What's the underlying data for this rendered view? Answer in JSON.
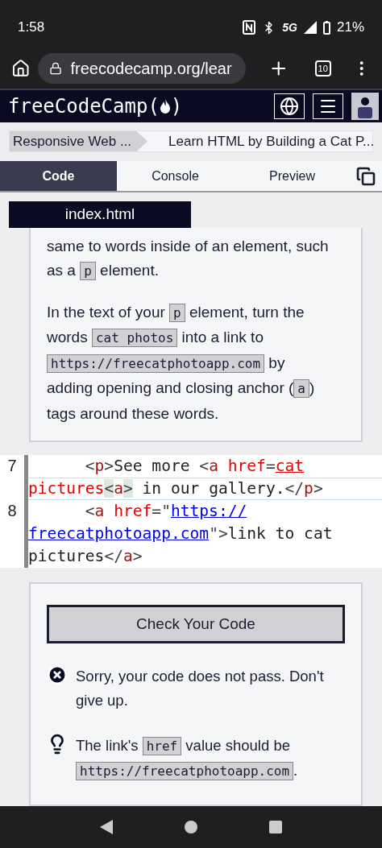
{
  "status_bar": {
    "time": "1:58",
    "network": "5G",
    "battery": "21%"
  },
  "browser": {
    "url": "freecodecamp.org/lear",
    "tab_count": "10"
  },
  "nav": {
    "logo_text": "freeCodeCamp",
    "logo_open": "(",
    "logo_close": ")"
  },
  "breadcrumb": [
    {
      "label": "Responsive Web ..."
    },
    {
      "label": "Learn HTML by Building a Cat P..."
    }
  ],
  "tabs": [
    {
      "label": "Code",
      "selected": true
    },
    {
      "label": "Console",
      "selected": false
    },
    {
      "label": "Preview",
      "selected": false
    }
  ],
  "file_tabs": [
    {
      "label": "index.html",
      "selected": true
    }
  ],
  "instructions": [
    [
      {
        "kind": "text",
        "text": "same to words inside of an element, such as a "
      },
      {
        "kind": "code",
        "text": "p"
      },
      {
        "kind": "text",
        "text": " element."
      }
    ],
    [
      {
        "kind": "text",
        "text": "In the text of your "
      },
      {
        "kind": "code",
        "text": "p"
      },
      {
        "kind": "text",
        "text": " element, turn the words "
      },
      {
        "kind": "code",
        "text": "cat photos"
      },
      {
        "kind": "text",
        "text": " into a link to "
      },
      {
        "kind": "code",
        "text": "https://freecatphotoapp.com"
      },
      {
        "kind": "text",
        "text": " by adding opening and closing anchor ("
      },
      {
        "kind": "code",
        "text": "a"
      },
      {
        "kind": "text",
        "text": ") tags around these words."
      }
    ]
  ],
  "editor": [
    {
      "number": "7",
      "rows": [
        {
          "tokens": [
            {
              "kind": "punct",
              "text": "<"
            },
            {
              "kind": "tag",
              "text": "p"
            },
            {
              "kind": "punct",
              "text": ">"
            },
            {
              "kind": "text",
              "text": "See more "
            },
            {
              "kind": "punct",
              "text": "<"
            },
            {
              "kind": "tag",
              "text": "a"
            },
            {
              "kind": "attr",
              "text": " href"
            },
            {
              "kind": "punct",
              "text": "="
            },
            {
              "kind": "error",
              "text": "cat"
            }
          ]
        },
        {
          "tokens": [
            {
              "kind": "attr",
              "text": "pictures"
            },
            {
              "kind": "match",
              "text": "<"
            },
            {
              "kind": "tag",
              "text": "a"
            },
            {
              "kind": "match",
              "text": ">"
            },
            {
              "kind": "text",
              "text": " in our gallery."
            },
            {
              "kind": "punct",
              "text": "</"
            },
            {
              "kind": "tag",
              "text": "p"
            },
            {
              "kind": "punct",
              "text": ">"
            }
          ]
        }
      ]
    },
    {
      "number": "8",
      "rows": [
        {
          "tokens": [
            {
              "kind": "punct",
              "text": "<"
            },
            {
              "kind": "tag",
              "text": "a"
            },
            {
              "kind": "attr",
              "text": " href"
            },
            {
              "kind": "punct",
              "text": "=\""
            },
            {
              "kind": "url",
              "text": "https://"
            }
          ]
        },
        {
          "tokens": [
            {
              "kind": "url",
              "text": "freecatphotoapp.com"
            },
            {
              "kind": "punct",
              "text": "\">"
            },
            {
              "kind": "text",
              "text": "link to cat"
            }
          ]
        },
        {
          "tokens": [
            {
              "kind": "text",
              "text": "pictures"
            },
            {
              "kind": "punct",
              "text": "</"
            },
            {
              "kind": "tag",
              "text": "a"
            },
            {
              "kind": "punct",
              "text": ">"
            }
          ]
        }
      ]
    }
  ],
  "check_button": "Check Your Code",
  "feedback": [
    {
      "kind": "error",
      "parts": [
        {
          "kind": "text",
          "text": "Sorry, your code does not pass. Don't give up."
        }
      ]
    },
    {
      "kind": "hint",
      "parts": [
        {
          "kind": "text",
          "text": "The link's "
        },
        {
          "kind": "code",
          "text": "href"
        },
        {
          "kind": "text",
          "text": " value should be "
        },
        {
          "kind": "code",
          "text": "https://freecatphotoapp.com"
        },
        {
          "kind": "text",
          "text": "."
        }
      ]
    }
  ]
}
